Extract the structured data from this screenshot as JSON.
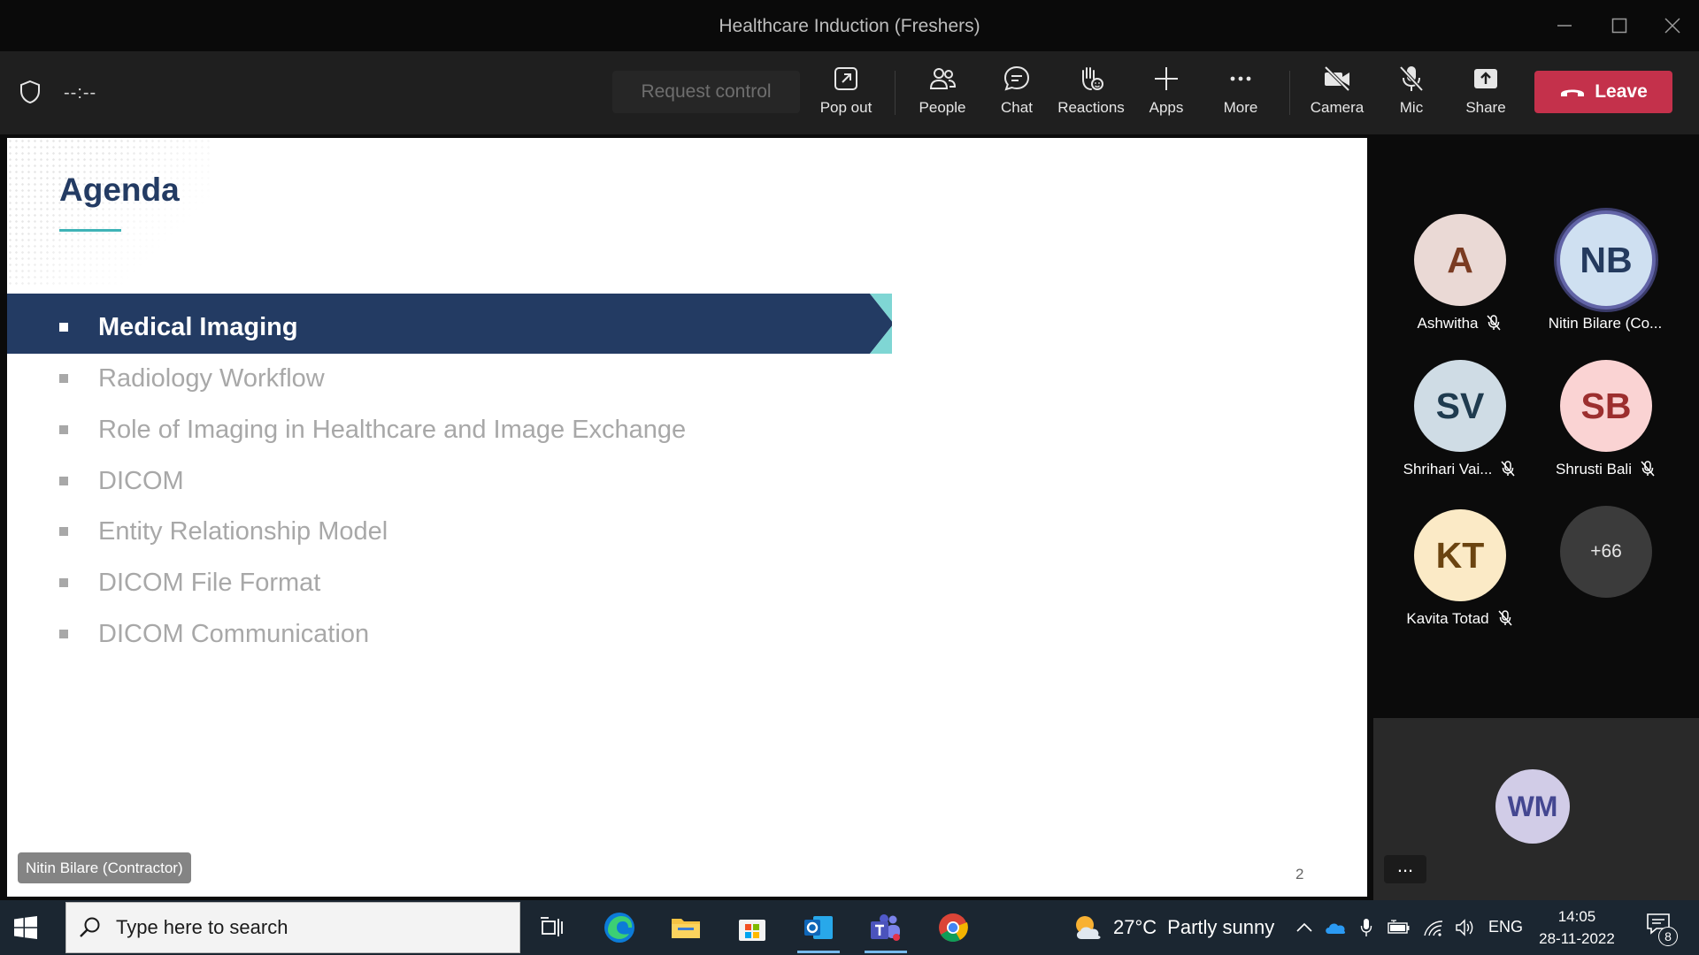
{
  "window": {
    "title": "Healthcare Induction (Freshers)"
  },
  "toolbar": {
    "timer": "--:--",
    "request_control": "Request control",
    "buttons": {
      "pop_out": "Pop out",
      "people": "People",
      "chat": "Chat",
      "reactions": "Reactions",
      "apps": "Apps",
      "more": "More",
      "camera": "Camera",
      "mic": "Mic",
      "share": "Share"
    },
    "leave": "Leave",
    "leave_color": "#c4314b"
  },
  "slide": {
    "heading": "Agenda",
    "accent_color": "#3fb3b7",
    "banner_color": "#233b63",
    "items": [
      {
        "label": "Medical Imaging",
        "active": true
      },
      {
        "label": "Radiology Workflow",
        "active": false
      },
      {
        "label": "Role of Imaging in Healthcare and Image Exchange",
        "active": false
      },
      {
        "label": "DICOM",
        "active": false
      },
      {
        "label": "Entity Relationship Model",
        "active": false
      },
      {
        "label": "DICOM File Format",
        "active": false
      },
      {
        "label": "DICOM Communication",
        "active": false
      }
    ],
    "page_number": "2"
  },
  "presenter_tag": "Nitin Bilare (Contractor)",
  "participants": [
    {
      "initials": "A",
      "name": "Ashwitha",
      "muted": true,
      "bg": "#ead9d5",
      "fg": "#7a3b22"
    },
    {
      "initials": "NB",
      "name": "Nitin Bilare (Co...",
      "muted": false,
      "bg": "#cfe0f1",
      "fg": "#243a5e",
      "speaking": true
    },
    {
      "initials": "SV",
      "name": "Shrihari Vai...",
      "muted": true,
      "bg": "#cfdce5",
      "fg": "#1f3b4f"
    },
    {
      "initials": "SB",
      "name": "Shrusti Bali",
      "muted": true,
      "bg": "#fad3d3",
      "fg": "#9c2e2e"
    },
    {
      "initials": "KT",
      "name": "Kavita Totad",
      "muted": true,
      "bg": "#fbeac6",
      "fg": "#6b4410"
    }
  ],
  "overflow_count": "+66",
  "self_view": {
    "initials": "WM",
    "more": "..."
  },
  "taskbar": {
    "search_placeholder": "Type here to search",
    "weather": {
      "temp": "27°C",
      "condition": "Partly sunny"
    },
    "language": "ENG",
    "time": "14:05",
    "date": "28-11-2022",
    "notification_count": "8"
  }
}
